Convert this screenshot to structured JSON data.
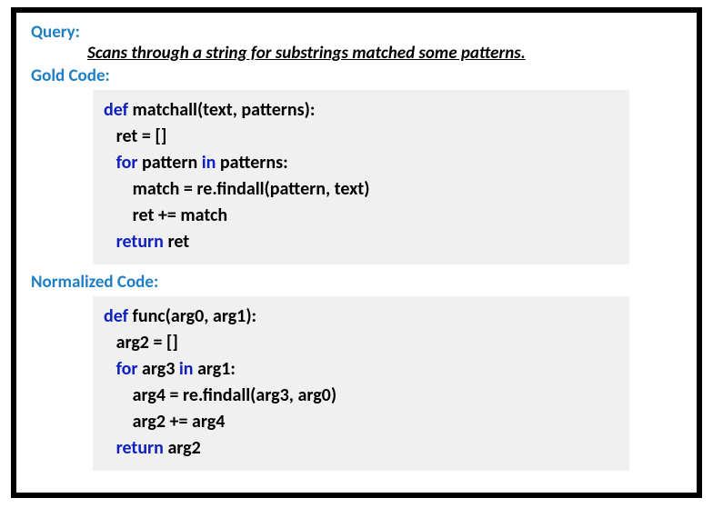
{
  "labels": {
    "query": "Query:",
    "gold": "Gold Code:",
    "normalized": "Normalized Code:"
  },
  "query_text": "Scans through a string for substrings matched some patterns.",
  "gold_code": {
    "l1": {
      "kw": "def ",
      "rest": "matchall(text, patterns):"
    },
    "l2": {
      "rest": "   ret = []"
    },
    "l3": {
      "pre": "   ",
      "kw1": "for ",
      "mid": "pattern ",
      "kw2": "in ",
      "end": "patterns:"
    },
    "l4": {
      "rest": "       match = re.findall(pattern, text)"
    },
    "l5": {
      "rest": "       ret += match"
    },
    "l6": {
      "pre": "   ",
      "kw": "return ",
      "end": "ret"
    }
  },
  "norm_code": {
    "l1": {
      "kw": "def ",
      "rest": "func(arg0, arg1):"
    },
    "l2": {
      "rest": "   arg2 = []"
    },
    "l3": {
      "pre": "   ",
      "kw1": "for ",
      "mid": "arg3 ",
      "kw2": "in ",
      "end": "arg1:"
    },
    "l4": {
      "rest": "       arg4 = re.findall(arg3, arg0)"
    },
    "l5": {
      "rest": "       arg2 += arg4"
    },
    "l6": {
      "pre": "   ",
      "kw": "return ",
      "end": "arg2"
    }
  }
}
